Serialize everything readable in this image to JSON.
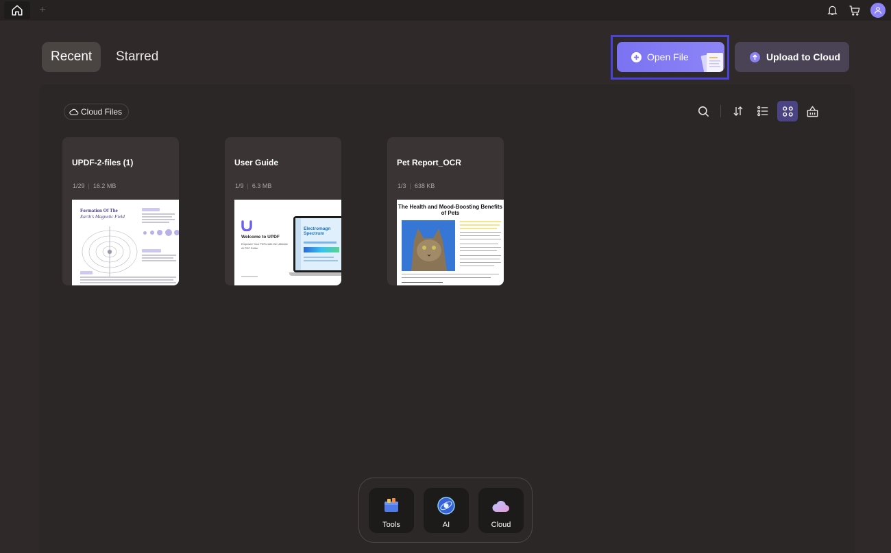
{
  "tabs": [
    {
      "label": "Recent",
      "active": true
    },
    {
      "label": "Starred",
      "active": false
    }
  ],
  "actions": {
    "open_file_label": "Open File",
    "upload_label": "Upload to Cloud"
  },
  "filter": {
    "cloud_files_label": "Cloud Files"
  },
  "toolbar": {
    "icons": [
      "search-icon",
      "sort-icon",
      "list-view-icon",
      "grid-view-icon",
      "basket-icon"
    ],
    "active_view": "grid"
  },
  "files": [
    {
      "name": "UPDF-2-files (1)",
      "pages": "1/29",
      "size": "16.2 MB",
      "thumb": {
        "title": "Formation Of The",
        "subtitle": "Earth's Magnetic Field"
      }
    },
    {
      "name": "User Guide",
      "pages": "1/9",
      "size": "6.3 MB",
      "thumb": {
        "title": "Welcome to UPDF",
        "subtitle": "Empower Your PDFs with the Ultimate AI PDF Editor",
        "screen_title": "Electromagn Spectrum"
      }
    },
    {
      "name": "Pet Report_OCR",
      "pages": "1/3",
      "size": "638 KB",
      "thumb": {
        "title": "The Health and Mood-Boosting Benefits of Pets"
      }
    }
  ],
  "dock": [
    {
      "label": "Tools",
      "icon": "tools-icon"
    },
    {
      "label": "AI",
      "icon": "ai-icon"
    },
    {
      "label": "Cloud",
      "icon": "cloud-icon"
    }
  ],
  "colors": {
    "accent": "#7b72f2",
    "background": "#2f2a29",
    "panel": "#2b2726",
    "card": "#3a3534",
    "highlight_border": "#4a44d8"
  }
}
